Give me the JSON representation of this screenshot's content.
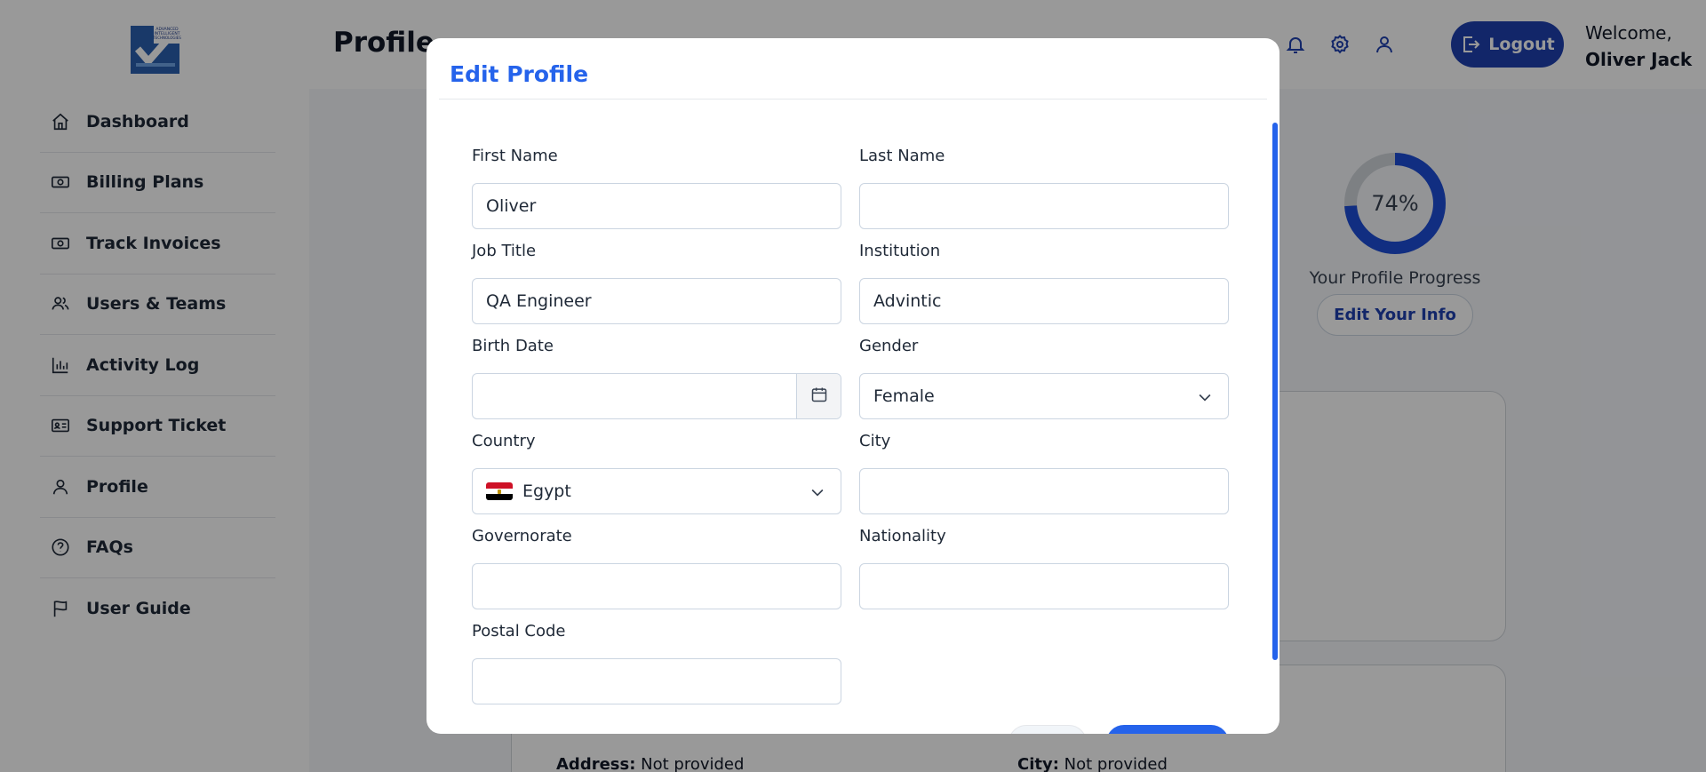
{
  "logo": {
    "alt_text": "ADVANCED INTELLIGENT TECHNOLOGIES"
  },
  "sidebar": {
    "items": [
      {
        "label": "Dashboard",
        "icon": "home-icon"
      },
      {
        "label": "Billing Plans",
        "icon": "money-icon"
      },
      {
        "label": "Track Invoices",
        "icon": "money-icon"
      },
      {
        "label": "Users & Teams",
        "icon": "users-icon"
      },
      {
        "label": "Activity Log",
        "icon": "bar-chart-icon"
      },
      {
        "label": "Support Ticket",
        "icon": "id-card-icon"
      },
      {
        "label": "Profile",
        "icon": "user-icon"
      },
      {
        "label": "FAQs",
        "icon": "help-circle-icon"
      },
      {
        "label": "User Guide",
        "icon": "flag-icon"
      }
    ]
  },
  "header": {
    "title": "Profile",
    "logout_label": "Logout",
    "welcome": "Welcome,",
    "user_name": "Oliver Jack"
  },
  "profile_progress": {
    "value_percent": 74,
    "value_label": "74%",
    "label": "Your Profile Progress",
    "edit_button": "Edit Your Info"
  },
  "background_details": {
    "address_label": "Address:",
    "address_value": "Not provided",
    "city_label": "City:",
    "city_value": "Not provided"
  },
  "modal": {
    "title": "Edit Profile",
    "fields": {
      "first_name": {
        "label": "First Name",
        "value": "Oliver"
      },
      "last_name": {
        "label": "Last Name",
        "value": ""
      },
      "job_title": {
        "label": "Job Title",
        "value": "QA Engineer"
      },
      "institution": {
        "label": "Institution",
        "value": "Advintic"
      },
      "birth_date": {
        "label": "Birth Date",
        "value": ""
      },
      "gender": {
        "label": "Gender",
        "value": "Female"
      },
      "country": {
        "label": "Country",
        "value": "Egypt"
      },
      "city": {
        "label": "City",
        "value": ""
      },
      "governorate": {
        "label": "Governorate",
        "value": ""
      },
      "nationality": {
        "label": "Nationality",
        "value": ""
      },
      "postal_code": {
        "label": "Postal Code",
        "value": ""
      }
    }
  },
  "colors": {
    "primary": "#2563eb",
    "primary_dark": "#1e40af",
    "progress": "#1d4ed8",
    "progress_track": "#d1d5db",
    "overlay": "rgba(0,0,0,0.4)"
  }
}
